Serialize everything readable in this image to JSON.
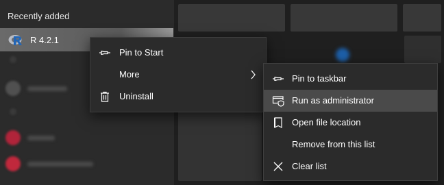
{
  "start_menu": {
    "section_title": "Recently added",
    "recent_app": {
      "name": "R 4.2.1",
      "icon": "r-logo-icon"
    }
  },
  "context_menu": {
    "items": [
      {
        "label": "Pin to Start",
        "icon": "pin-icon"
      },
      {
        "label": "More",
        "icon": "chevron-right-icon"
      },
      {
        "label": "Uninstall",
        "icon": "trash-icon"
      }
    ]
  },
  "submenu": {
    "items": [
      {
        "label": "Pin to taskbar",
        "icon": "pin-icon"
      },
      {
        "label": "Run as administrator",
        "icon": "shield-window-icon",
        "highlighted": true
      },
      {
        "label": "Open file location",
        "icon": "document-icon"
      },
      {
        "label": "Remove from this list",
        "icon": ""
      },
      {
        "label": "Clear list",
        "icon": "close-icon"
      }
    ]
  },
  "colors": {
    "menu_bg": "#2b2b2b",
    "highlight": "#4a4a4a",
    "r_blue": "#2166b8"
  }
}
